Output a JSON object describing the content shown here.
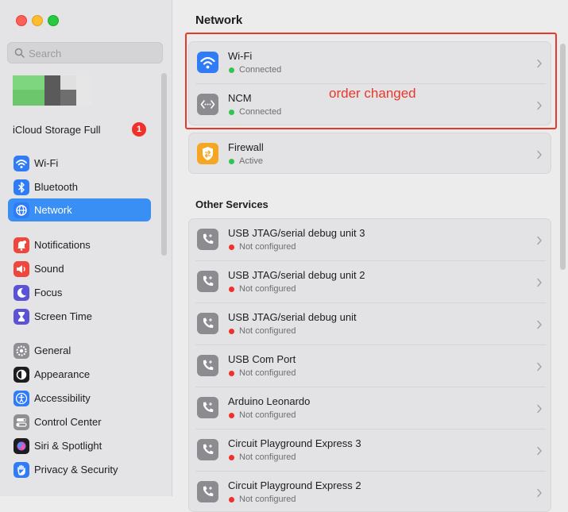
{
  "sidebar": {
    "search_placeholder": "Search",
    "icloud_label": "iCloud Storage Full",
    "icloud_badge": "1",
    "items": [
      {
        "label": "Wi-Fi",
        "icon": "wifi-icon",
        "color": "#2f7cf6"
      },
      {
        "label": "Bluetooth",
        "icon": "bluetooth-icon",
        "color": "#2f7cf6"
      },
      {
        "label": "Network",
        "icon": "globe-icon",
        "color": "#2f7cf6",
        "active": true
      },
      {
        "label": "Notifications",
        "icon": "bell-icon",
        "color": "#f0463c"
      },
      {
        "label": "Sound",
        "icon": "speaker-icon",
        "color": "#f0463c"
      },
      {
        "label": "Focus",
        "icon": "moon-icon",
        "color": "#5b52d6"
      },
      {
        "label": "Screen Time",
        "icon": "hourglass-icon",
        "color": "#5b52d6"
      },
      {
        "label": "General",
        "icon": "gear-icon",
        "color": "#8e8e93"
      },
      {
        "label": "Appearance",
        "icon": "appearance-icon",
        "color": "#1d1d1f"
      },
      {
        "label": "Accessibility",
        "icon": "accessibility-icon",
        "color": "#2f7cf6"
      },
      {
        "label": "Control Center",
        "icon": "control-center-icon",
        "color": "#8e8e93"
      },
      {
        "label": "Siri & Spotlight",
        "icon": "siri-icon",
        "color": "#1d1d1f"
      },
      {
        "label": "Privacy & Security",
        "icon": "hand-icon",
        "color": "#2f7cf6"
      }
    ]
  },
  "main": {
    "title": "Network",
    "annotation": "order changed",
    "top_services": [
      {
        "name": "Wi-Fi",
        "status": "Connected",
        "status_color": "#32c552",
        "icon": "wifi-icon"
      },
      {
        "name": "NCM",
        "status": "Connected",
        "status_color": "#32c552",
        "icon": "ethernet-icon"
      }
    ],
    "firewall": {
      "name": "Firewall",
      "status": "Active",
      "status_color": "#32c552",
      "icon": "firewall-icon"
    },
    "other_title": "Other Services",
    "other_services": [
      {
        "name": "USB JTAG/serial debug unit 3",
        "status": "Not configured",
        "status_color": "#f0302b"
      },
      {
        "name": "USB JTAG/serial debug unit 2",
        "status": "Not configured",
        "status_color": "#f0302b"
      },
      {
        "name": "USB JTAG/serial debug unit",
        "status": "Not configured",
        "status_color": "#f0302b"
      },
      {
        "name": "USB Com Port",
        "status": "Not configured",
        "status_color": "#f0302b"
      },
      {
        "name": "Arduino Leonardo",
        "status": "Not configured",
        "status_color": "#f0302b"
      },
      {
        "name": "Circuit Playground Express 3",
        "status": "Not configured",
        "status_color": "#f0302b"
      },
      {
        "name": "Circuit Playground Express 2",
        "status": "Not configured",
        "status_color": "#f0302b"
      }
    ]
  }
}
